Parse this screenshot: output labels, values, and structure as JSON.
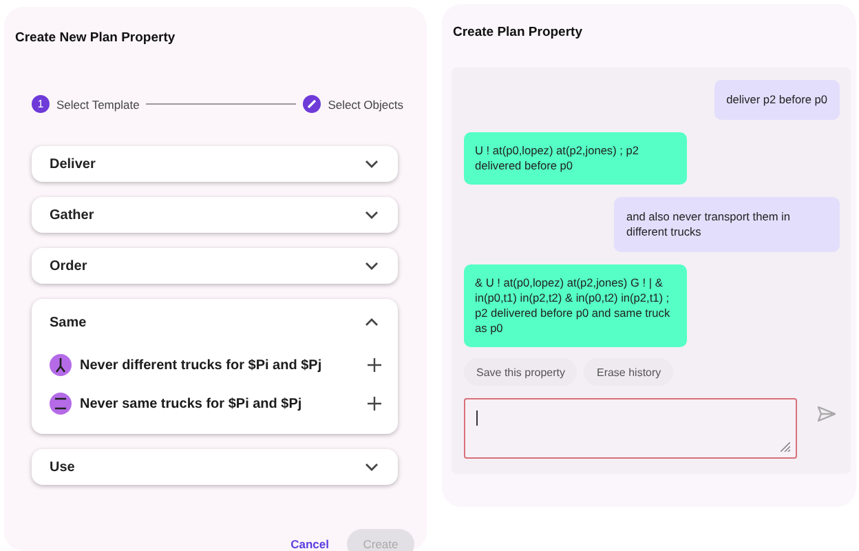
{
  "left_panel": {
    "title": "Create New Plan Property",
    "steps": [
      {
        "kind": "number",
        "number": "1",
        "label": "Select Template"
      },
      {
        "kind": "edit",
        "label": "Select Objects"
      }
    ],
    "groups": [
      {
        "title": "Deliver",
        "expanded": false
      },
      {
        "title": "Gather",
        "expanded": false
      },
      {
        "title": "Order",
        "expanded": false
      },
      {
        "title": "Same",
        "expanded": true,
        "items": [
          {
            "kind": "merge",
            "text": "Never different trucks for $Pi and $Pj"
          },
          {
            "kind": "separate",
            "text": "Never same trucks for $Pi and $Pj"
          }
        ]
      },
      {
        "title": "Use",
        "expanded": false
      }
    ],
    "cancel_button": {
      "label": "Cancel"
    },
    "create_button": {
      "label": "Create",
      "disabled": true
    }
  },
  "right_panel": {
    "title": "Create Plan Property",
    "messages": [
      {
        "kind": "user",
        "text": "deliver p2 before p0"
      },
      {
        "kind": "bot",
        "text": "U ! at(p0,lopez) at(p2,jones) ; p2 delivered before p0"
      },
      {
        "kind": "user",
        "text": "and also never transport them in different trucks"
      },
      {
        "kind": "bot",
        "text": "& U ! at(p0,lopez) at(p2,jones) G ! | & in(p0,t1) in(p2,t2) & in(p0,t2) in(p2,t1) ; p2 delivered before p0 and same truck as p0"
      }
    ],
    "chips": [
      "Save this property",
      "Erase history"
    ],
    "input": {
      "invalid": true
    }
  }
}
